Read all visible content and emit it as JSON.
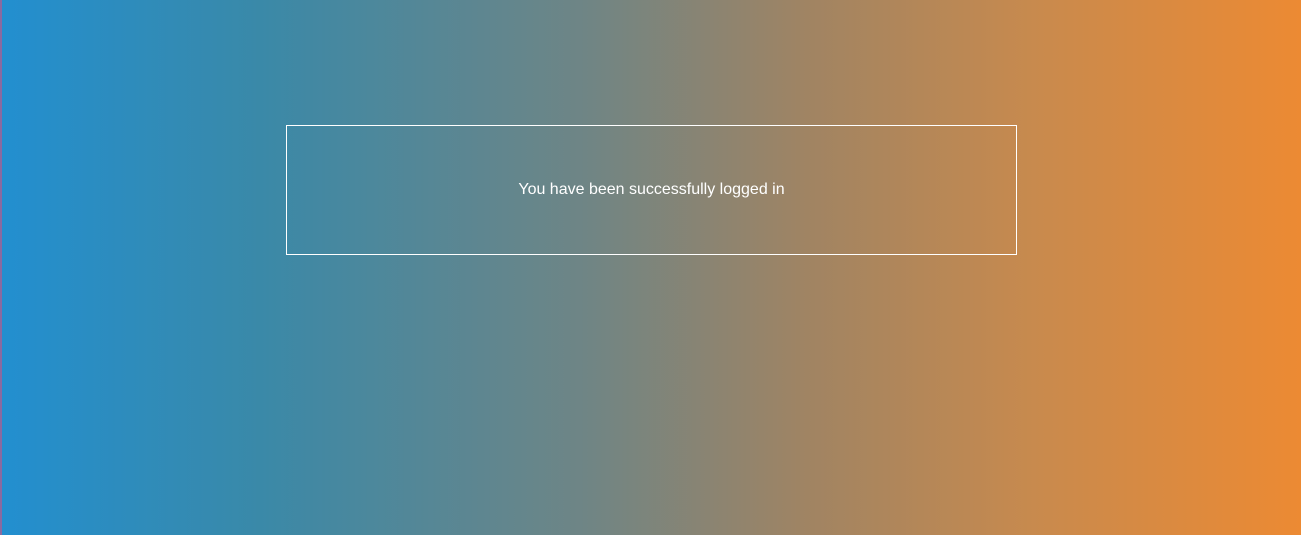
{
  "message": {
    "text": "You have been successfully logged in"
  },
  "colors": {
    "gradient_start": "#228fd0",
    "gradient_end": "#ec8a33",
    "box_border": "#ffffff",
    "text": "#ffffff"
  }
}
